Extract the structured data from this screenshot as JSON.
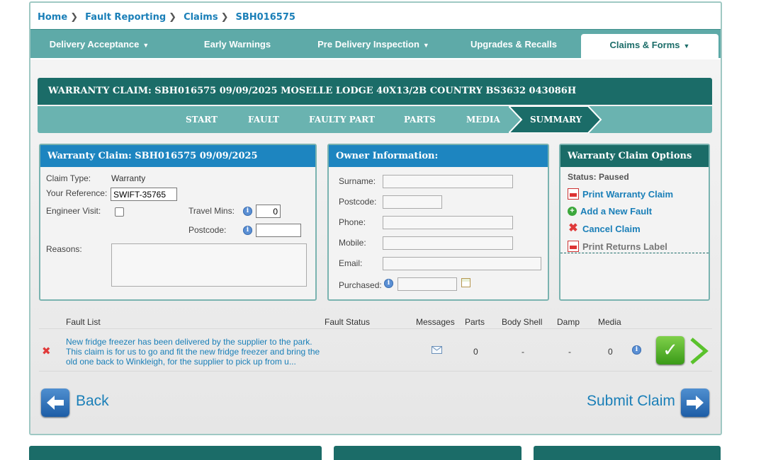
{
  "breadcrumb": [
    {
      "label": "Home"
    },
    {
      "label": "Fault Reporting"
    },
    {
      "label": "Claims"
    },
    {
      "label": "SBH016575"
    }
  ],
  "nav": {
    "delivery_acceptance": "Delivery Acceptance",
    "early_warnings": "Early Warnings",
    "pre_delivery_inspection": "Pre Delivery Inspection",
    "upgrades_recalls": "Upgrades & Recalls",
    "claims_forms": "Claims & Forms"
  },
  "title_bar": "WARRANTY CLAIM: SBH016575 09/09/2025 MOSELLE LODGE 40X13/2B COUNTRY BS3632 043086H",
  "steps": {
    "start": "START",
    "fault": "FAULT",
    "faulty_part": "FAULTY PART",
    "parts": "PARTS",
    "media": "MEDIA",
    "summary": "SUMMARY"
  },
  "warranty_panel": {
    "title": "Warranty Claim: SBH016575 09/09/2025",
    "claim_type_label": "Claim Type:",
    "claim_type_value": "Warranty",
    "your_reference_label": "Your Reference:",
    "your_reference_value": "SWIFT-35765",
    "engineer_visit_label": "Engineer Visit:",
    "travel_mins_label": "Travel Mins:",
    "travel_mins_value": "0",
    "postcode_label": "Postcode:",
    "postcode_value": "",
    "reasons_label": "Reasons:",
    "reasons_value": ""
  },
  "owner_panel": {
    "title": "Owner Information:",
    "surname_label": "Surname:",
    "postcode_label": "Postcode:",
    "phone_label": "Phone:",
    "mobile_label": "Mobile:",
    "email_label": "Email:",
    "purchased_label": "Purchased:"
  },
  "options_panel": {
    "title": "Warranty Claim Options",
    "status": "Status: Paused",
    "print_claim": "Print Warranty Claim",
    "add_fault": "Add a New Fault",
    "cancel_claim": "Cancel Claim",
    "print_returns": "Print Returns Label"
  },
  "fault_table": {
    "headers": {
      "fault_list": "Fault List",
      "fault_status": "Fault Status",
      "messages": "Messages",
      "parts": "Parts",
      "body_shell": "Body Shell",
      "damp": "Damp",
      "media": "Media"
    },
    "rows": [
      {
        "description": "New fridge freezer has been delivered by the supplier to the park. This claim is for us to go and fit the new fridge freezer and bring the old one back to Winkleigh, for the supplier to pick up from u...",
        "parts": "0",
        "body_shell": "-",
        "damp": "-",
        "media": "0"
      }
    ]
  },
  "footer": {
    "back": "Back",
    "submit": "Submit Claim"
  },
  "colors": {
    "teal_dark": "#1b6c68",
    "teal_light": "#5eaaa8",
    "blue_header": "#1d85c0",
    "link_blue": "#1a7fb8"
  }
}
